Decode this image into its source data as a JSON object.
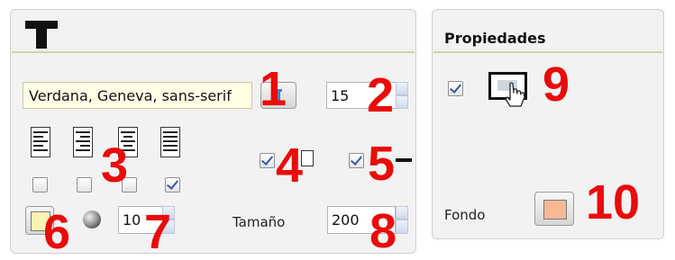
{
  "text_panel": {
    "header_icon": "text-tool-T-icon",
    "font_family_value": "Verdana, Geneva, sans-serif",
    "font_size_value": "15",
    "align_icons": [
      "align-left-icon",
      "align-right-icon",
      "align-center-icon",
      "align-justify-icon"
    ],
    "align_checkboxes": [
      false,
      false,
      false,
      true
    ],
    "underline_checked": true,
    "strikethrough_checked": true,
    "size_label": "Tamaño",
    "size_value": "200",
    "opacity_value": "10",
    "color_swatch": "#fbf3b0"
  },
  "properties_panel": {
    "title": "Propiedades",
    "cursor_checked": true,
    "cursor_icon": "hand-pointer-cursor-icon",
    "background_label": "Fondo",
    "background_color": "#f7b896"
  },
  "callouts": [
    "1",
    "2",
    "3",
    "4",
    "5",
    "6",
    "7",
    "8",
    "9",
    "10"
  ],
  "colors": {
    "callout": "#ea0b0b",
    "panel_bg": "#f2f2f2",
    "divider": "#cbd8a6",
    "checkmark": "#3a55b0"
  }
}
